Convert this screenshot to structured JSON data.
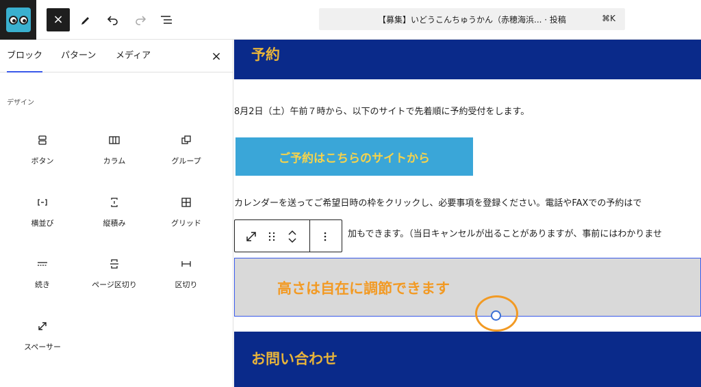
{
  "topbar": {
    "close_label": "×",
    "command_title": "【募集】いどうこんちゅうかん（赤穂海浜... · 投稿",
    "command_shortcut": "⌘K"
  },
  "sidebar": {
    "tabs": [
      {
        "label": "ブロック",
        "active": true
      },
      {
        "label": "パターン",
        "active": false
      },
      {
        "label": "メディア",
        "active": false
      }
    ],
    "close_label": "×",
    "category": "デザイン",
    "blocks": [
      {
        "label": "ボタン",
        "icon": "buttons-icon"
      },
      {
        "label": "カラム",
        "icon": "columns-icon"
      },
      {
        "label": "グループ",
        "icon": "group-icon"
      },
      {
        "label": "横並び",
        "icon": "row-icon"
      },
      {
        "label": "縦積み",
        "icon": "stack-icon"
      },
      {
        "label": "グリッド",
        "icon": "grid-icon"
      },
      {
        "label": "続き",
        "icon": "more-icon"
      },
      {
        "label": "ページ区切り",
        "icon": "page-break-icon"
      },
      {
        "label": "区切り",
        "icon": "separator-icon"
      },
      {
        "label": "スペーサー",
        "icon": "spacer-icon"
      }
    ]
  },
  "content": {
    "heading1": "予約",
    "para1": "8月2日（土）午前７時から、以下のサイトで先着順に予約受付をします。",
    "cta_label": "ご予約はこちらのサイトから",
    "para2": "カレンダーを送ってご希望日時の枠をクリックし、必要事項を登録ください。電話やFAXでの予約はで",
    "para3": "加もできます。（当日キャンセルが出ることがありますが、事前にはわかりませ",
    "spacer_note": "高さは自在に調節できます",
    "heading2": "お問い合わせ"
  },
  "colors": {
    "banner": "#0a2a8a",
    "banner_text": "#e8b43a",
    "cta": "#3aa6d8",
    "cta_text": "#f6d34b",
    "note": "#f29a24",
    "accent": "#3858e9"
  }
}
